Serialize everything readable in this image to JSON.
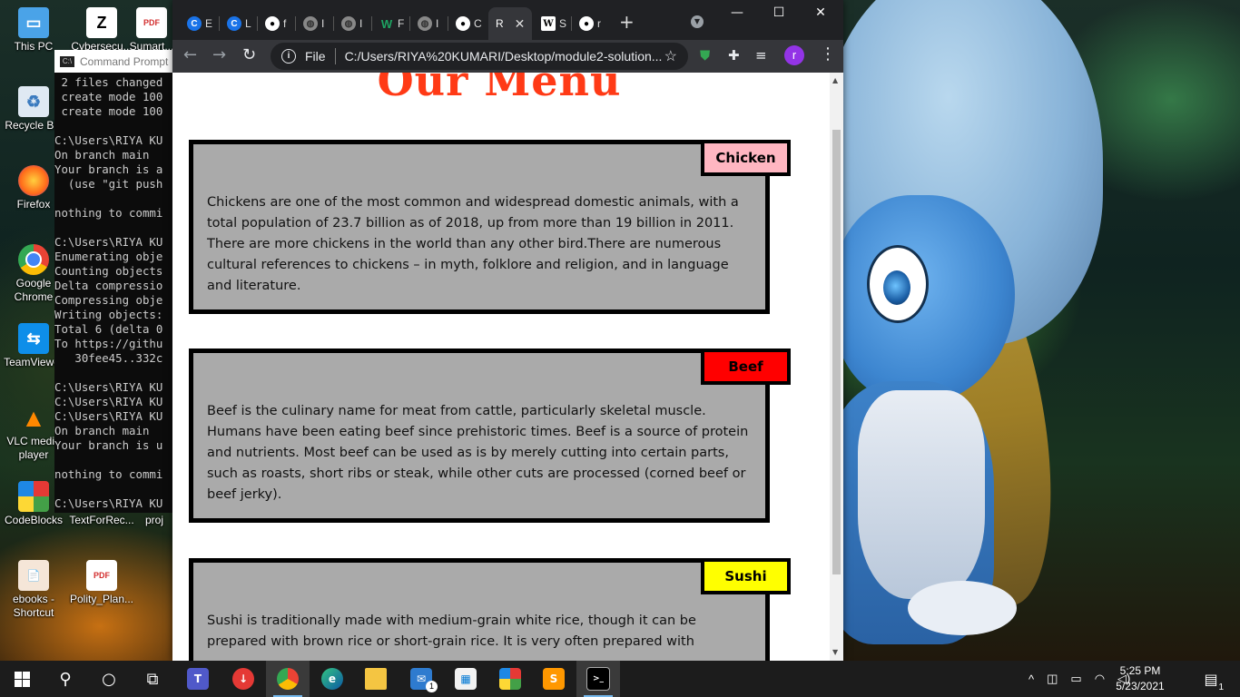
{
  "desktop": {
    "icons": [
      {
        "label": "This PC",
        "icon": "computer-icon"
      },
      {
        "label": "Cybersecu...",
        "icon": "shortcut-icon"
      },
      {
        "label": "Sumart...",
        "icon": "pdf-icon"
      },
      {
        "label": "Recycle Bin",
        "icon": "recycle-bin-icon"
      },
      {
        "label": "Firefox",
        "icon": "firefox-icon"
      },
      {
        "label": "Google Chrome",
        "icon": "chrome-icon"
      },
      {
        "label": "TeamViewer",
        "icon": "teamviewer-icon"
      },
      {
        "label": "VLC media player",
        "icon": "vlc-icon"
      },
      {
        "label": "CodeBlocks",
        "icon": "codeblocks-icon"
      },
      {
        "label": "TextForRec...",
        "icon": "text-file-icon"
      },
      {
        "label": "proj",
        "icon": "folder-icon"
      },
      {
        "label": "ebooks - Shortcut",
        "icon": "shortcut-icon"
      },
      {
        "label": "Polity_Plan...",
        "icon": "pdf-icon"
      }
    ]
  },
  "cmd": {
    "title": "Command Prompt",
    "lines": [
      " 2 files changed",
      " create mode 100",
      " create mode 100",
      "",
      "C:\\Users\\RIYA KU",
      "On branch main",
      "Your branch is a",
      "  (use \"git push",
      "",
      "nothing to commi",
      "",
      "C:\\Users\\RIYA KU",
      "Enumerating obje",
      "Counting objects",
      "Delta compressio",
      "Compressing obje",
      "Writing objects:",
      "Total 6 (delta 0",
      "To https://githu",
      "   30fee45..332c",
      "",
      "C:\\Users\\RIYA KU",
      "C:\\Users\\RIYA KU",
      "C:\\Users\\RIYA KU",
      "On branch main",
      "Your branch is u",
      "",
      "nothing to commi",
      "",
      "C:\\Users\\RIYA KU"
    ]
  },
  "browser": {
    "tabs": [
      {
        "label": "E",
        "icon": "c-icon",
        "color": "#1a73e8"
      },
      {
        "label": "L",
        "icon": "c-icon",
        "color": "#1a73e8"
      },
      {
        "label": "f",
        "icon": "github-icon",
        "color": "#ffffff"
      },
      {
        "label": "I",
        "icon": "globe-icon",
        "color": "#888888"
      },
      {
        "label": "I",
        "icon": "globe-icon",
        "color": "#888888"
      },
      {
        "label": "F",
        "icon": "w-icon",
        "color": "#1ea362"
      },
      {
        "label": "I",
        "icon": "globe-icon",
        "color": "#888888"
      },
      {
        "label": "C",
        "icon": "github-icon",
        "color": "#ffffff"
      },
      {
        "label": "R",
        "icon": "",
        "color": "#ffffff"
      },
      {
        "label": "S",
        "icon": "wikipedia-icon",
        "color": "#ffffff"
      },
      {
        "label": "r",
        "icon": "github-icon",
        "color": "#ffffff"
      }
    ],
    "scheme": "File",
    "url": "C:/Users/RIYA%20KUMARI/Desktop/module2-solution...",
    "profile_initial": "r"
  },
  "page": {
    "title": "Our Menu",
    "cards": [
      {
        "label": "Chicken",
        "label_color": "#ffb6c1",
        "text": "Chickens are one of the most common and widespread domestic animals, with a total population of 23.7 billion as of 2018, up from more than 19 billion in 2011. There are more chickens in the world than any other bird.There are numerous cultural references to chickens – in myth, folklore and religion, and in language and literature."
      },
      {
        "label": "Beef",
        "label_color": "#ff0000",
        "text": "Beef is the culinary name for meat from cattle, particularly skeletal muscle. Humans have been eating beef since prehistoric times. Beef is a source of protein and nutrients. Most beef can be used as is by merely cutting into certain parts, such as roasts, short ribs or steak, while other cuts are processed (corned beef or beef jerky)."
      },
      {
        "label": "Sushi",
        "label_color": "#ffff00",
        "text": "Sushi is traditionally made with medium-grain white rice, though it can be prepared with brown rice or short-grain rice. It is very often prepared with"
      }
    ]
  },
  "taskbar": {
    "apps": [
      "teams-icon",
      "download-icon",
      "chrome-icon",
      "edge-icon",
      "file-explorer-icon",
      "mail-icon",
      "store-icon",
      "office-icon",
      "sublime-icon",
      "terminal-icon"
    ],
    "mail_badge": "1",
    "time": "5:25 PM",
    "date": "5/23/2021",
    "notification_badge": "1"
  }
}
